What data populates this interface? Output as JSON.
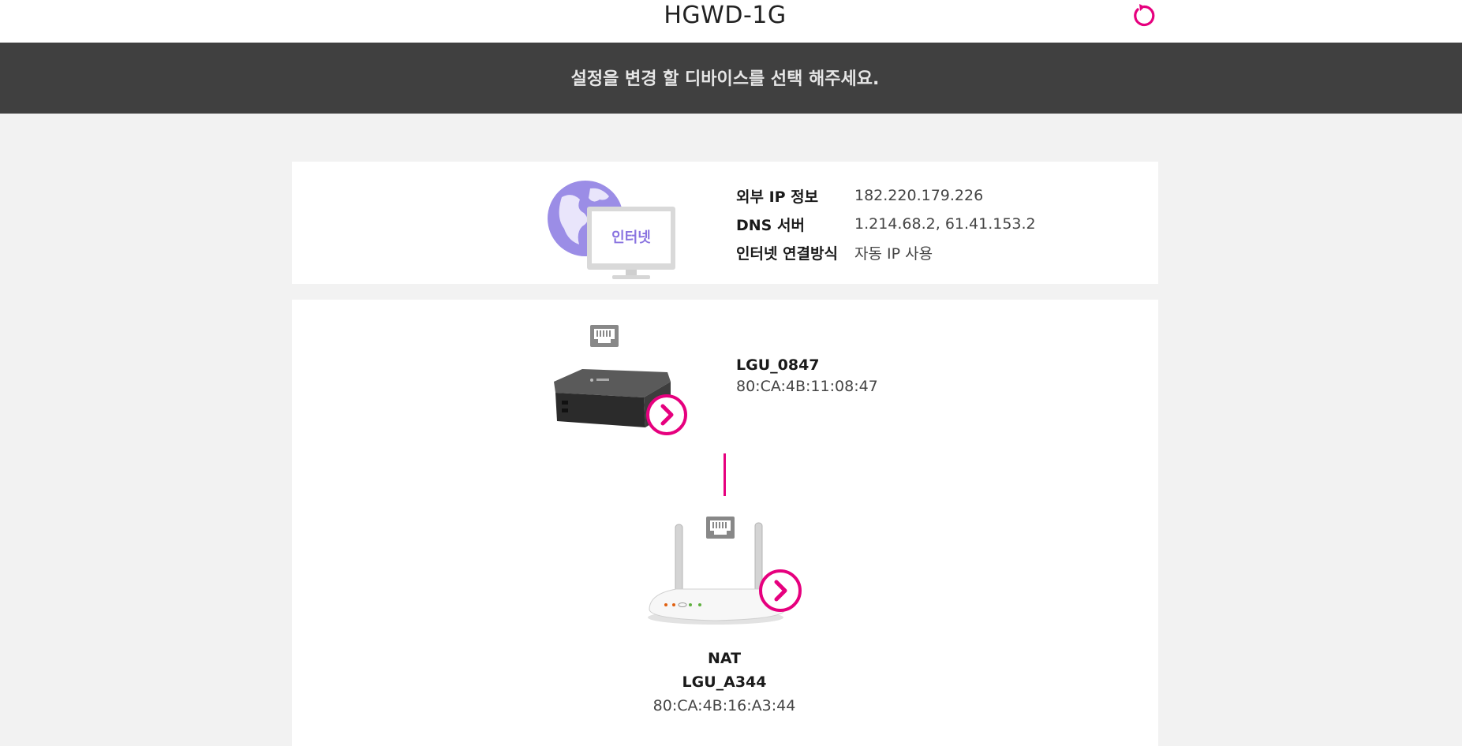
{
  "header": {
    "title": "HGWD-1G",
    "refresh_icon": "refresh-icon"
  },
  "banner": {
    "message": "설정을 변경 할 디바이스를 선택 해주세요."
  },
  "internet": {
    "icon_label": "인터넷",
    "rows": [
      {
        "label": "외부 IP 정보",
        "value": "182.220.179.226"
      },
      {
        "label": "DNS 서버",
        "value": "1.214.68.2, 61.41.153.2"
      },
      {
        "label": "인터넷 연결방식",
        "value": "자동 IP 사용"
      }
    ]
  },
  "devices": {
    "modem": {
      "name": "LGU_0847",
      "mac": "80:CA:4B:11:08:47"
    },
    "router": {
      "mode": "NAT",
      "name": "LGU_A344",
      "mac": "80:CA:4B:16:A3:44"
    }
  },
  "colors": {
    "accent": "#e6007e",
    "banner_bg": "#404040",
    "page_bg": "#f2f2f2",
    "globe": "#9b8de6"
  }
}
